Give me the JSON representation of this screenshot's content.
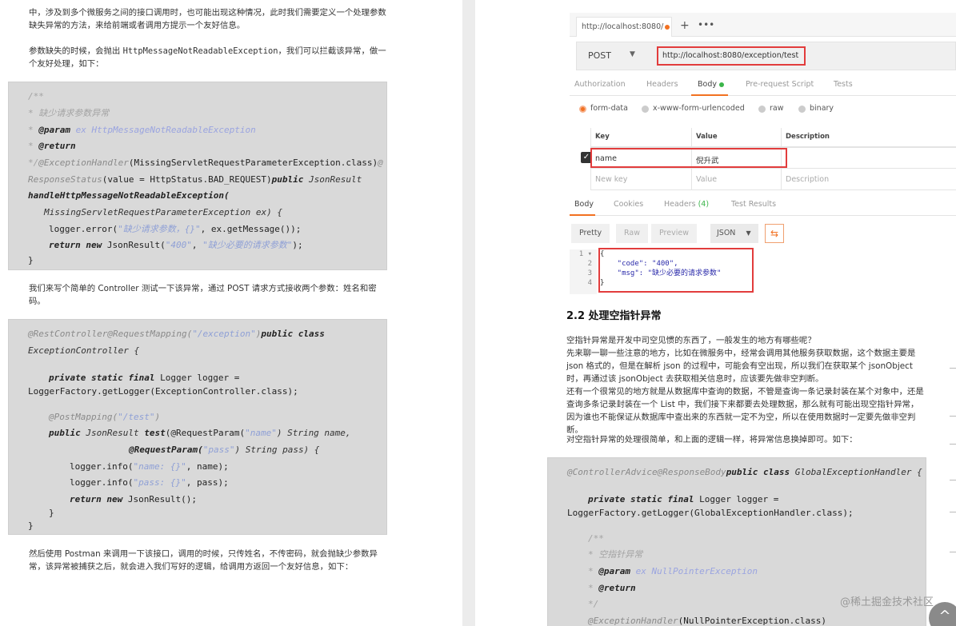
{
  "left": {
    "p1": "中，涉及到多个微服务之间的接口调用时，也可能出现这种情况，此时我们需要定义一个处理参数缺失异常的方法，来给前端或者调用方提示一个友好信息。",
    "p2_a": "参数缺失的时候，会抛出 ",
    "p2_code": "HttpMessageNotReadableException",
    "p2_b": "，我们可以拦截该异常，做一个友好处理，如下：",
    "code1": {
      "l1": "/**",
      "l2": "* 缺少请求参数异常",
      "l3_star": "* ",
      "l3_tag": "@param",
      "l3_rest": " ex HttpMessageNotReadableException",
      "l4_star": "* ",
      "l4_tag": "@return",
      "l5_c": "*/",
      "l5_ann": "@ExceptionHandler",
      "l5_rest": "(MissingServletRequestParameterException.class)",
      "l5_at": "@",
      "l6_ann": "ResponseStatus",
      "l6_rest": "(value = HttpStatus.BAD_REQUEST)",
      "l6_kw": "public",
      "l6_type": " JsonResult",
      "l7": "handleHttpMessageNotReadableException(",
      "l8": "MissingServletRequestParameterException ex) {",
      "l9_a": "logger.error(",
      "l9_str": "\"缺少请求参数，{}\"",
      "l9_b": ", ex.getMessage());",
      "l10_kw1": "return",
      "l10_kw2": "new",
      "l10_a": " JsonResult(",
      "l10_s1": "\"400\"",
      "l10_b": ", ",
      "l10_s2": "\"缺少必要的请求参数\"",
      "l10_c": ");",
      "l11": "}"
    },
    "p3": "我们来写个简单的 Controller 测试一下该异常，通过 POST 请求方式接收两个参数：姓名和密码。",
    "code2": {
      "l1_ann": "@RestController@RequestMapping(",
      "l1_str": "\"/exception\"",
      "l1_b": ")",
      "l1_kw": "public class",
      "l2": "ExceptionController {",
      "l3_kw": "private static final",
      "l3_rest": " Logger logger =",
      "l4": "LoggerFactory.getLogger(ExceptionController.class);",
      "l5_ann": "@PostMapping(",
      "l5_str": "\"/test\"",
      "l5_b": ")",
      "l6_kw": "public",
      "l6_type": " JsonResult ",
      "l6_m": "test",
      "l6_a": "(@RequestParam(",
      "l6_str": "\"name\"",
      "l6_b": ") String name,",
      "l7_a": "@RequestParam(",
      "l7_str": "\"pass\"",
      "l7_b": ") String pass) {",
      "l8_a": "logger.info(",
      "l8_str": "\"name: {}\"",
      "l8_b": ", name);",
      "l9_a": "logger.info(",
      "l9_str": "\"pass: {}\"",
      "l9_b": ", pass);",
      "l10_kw1": "return",
      "l10_kw2": "new",
      "l10_b": " JsonResult();",
      "l11": "}",
      "l12": "}"
    },
    "p4": "然后使用 Postman 来调用一下该接口，调用的时候，只传姓名，不传密码，就会抛缺少参数异常，该异常被捕获之后，就会进入我们写好的逻辑，给调用方返回一个友好信息，如下："
  },
  "postman": {
    "tab_label": "http://localhost:8080/",
    "plus": "+",
    "more": "•••",
    "method": "POST",
    "caret": "▼",
    "url": "http://localhost:8080/exception/test",
    "req_tabs": [
      "Authorization",
      "Headers",
      "Body",
      "Pre-request Script",
      "Tests"
    ],
    "body_types": [
      "form-data",
      "x-www-form-urlencoded",
      "raw",
      "binary"
    ],
    "table_headers": [
      "Key",
      "Value",
      "Description"
    ],
    "row_key": "name",
    "row_value": "倪升武",
    "new_key": "New key",
    "new_value": "Value",
    "new_desc": "Description",
    "check": "✓",
    "resp_tabs": [
      "Body",
      "Cookies",
      "Headers",
      "Test Results"
    ],
    "headers_count": "(4)",
    "view_buttons": [
      "Pretty",
      "Raw",
      "Preview"
    ],
    "json_label": "JSON",
    "json_caret": "▼",
    "wrap_icon": "⇆",
    "line_numbers": [
      "1 ▾",
      "2",
      "3",
      "4"
    ],
    "resp_lines": [
      "{",
      "    \"code\": \"400\",",
      "    \"msg\": \"缺少必要的请求参数\"",
      "}"
    ]
  },
  "right": {
    "heading": "2.2 处理空指针异常",
    "p1": "空指针异常是开发中司空见惯的东西了，一般发生的地方有哪些呢？",
    "p2": "先来聊一聊一些注意的地方，比如在微服务中，经常会调用其他服务获取数据，这个数据主要是 json 格式的，但是在解析 json 的过程中，可能会有空出现，所以我们在获取某个 jsonObject 时，再通过该 jsonObject 去获取相关信息时，应该要先做非空判断。",
    "p3": "还有一个很常见的地方就是从数据库中查询的数据，不管是查询一条记录封装在某个对象中，还是查询多条记录封装在一个 List 中，我们接下来都要去处理数据，那么就有可能出现空指针异常，因为谁也不能保证从数据库中查出来的东西就一定不为空，所以在使用数据时一定要先做非空判断。",
    "p4": "对空指针异常的处理很简单，和上面的逻辑一样，将异常信息换掉即可。如下：",
    "code3": {
      "l1_ann": "@ControllerAdvice@ResponseBody",
      "l1_kw": "public class",
      "l1_type": " GlobalExceptionHandler {",
      "l2_kw": "private static final",
      "l2_rest": " Logger logger =",
      "l3": "LoggerFactory.getLogger(GlobalExceptionHandler.class);",
      "l4": "/**",
      "l5": "* 空指针异常",
      "l6_star": "* ",
      "l6_tag": "@param",
      "l6_rest": " ex NullPointerException",
      "l7_star": "* ",
      "l7_tag": "@return",
      "l8": "*/",
      "l9_ann": "@ExceptionHandler",
      "l9_rest": "(NullPointerException.class)"
    },
    "watermark": "@稀土掘金技术社区",
    "scroll_icon": "^"
  }
}
